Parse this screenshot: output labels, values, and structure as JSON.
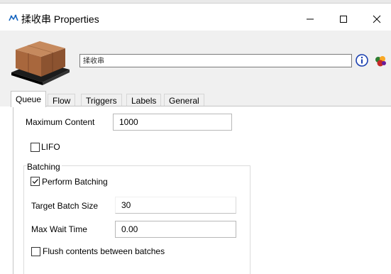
{
  "window": {
    "title": "揉收串 Properties",
    "controls": {
      "minimize": "—",
      "maximize": "☐",
      "close": "✕"
    }
  },
  "object": {
    "name_value": "揉收串"
  },
  "tabs": [
    {
      "label": "Queue",
      "active": true
    },
    {
      "label": "Flow",
      "active": false
    },
    {
      "label": "Triggers",
      "active": false
    },
    {
      "label": "Labels",
      "active": false
    },
    {
      "label": "General",
      "active": false
    }
  ],
  "queue": {
    "max_content_label": "Maximum Content",
    "max_content_value": "1000",
    "lifo_label": "LIFO",
    "lifo_checked": false,
    "batching": {
      "group_label": "Batching",
      "perform_label": "Perform Batching",
      "perform_checked": true,
      "target_label": "Target Batch Size",
      "target_value": "30",
      "wait_label": "Max Wait Time",
      "wait_value": "0.00",
      "flush_label": "Flush contents between batches",
      "flush_checked": false
    }
  },
  "colors": {
    "accent": "#0078d7",
    "panel_bg": "#f0f0f0"
  }
}
